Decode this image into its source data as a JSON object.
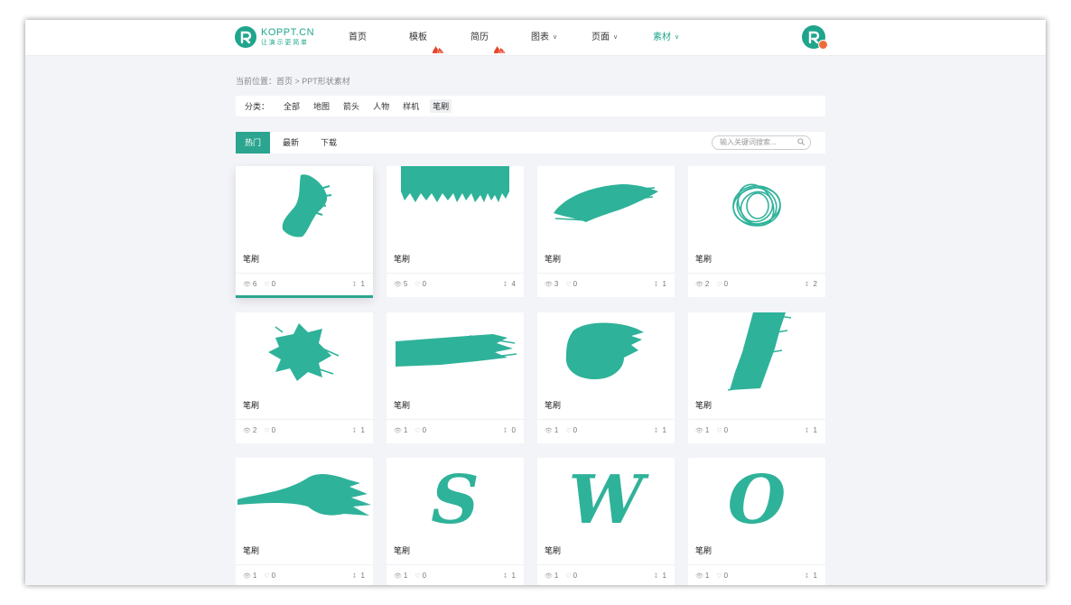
{
  "colors": {
    "accent": "#2ba590",
    "brush": "#2fb29a",
    "badge": "#ef6a3a",
    "background": "#f3f4f8"
  },
  "logo": {
    "title": "KOPPT.CN",
    "subtitle": "让演示更简单"
  },
  "nav": {
    "home": "首页",
    "templates": "模板",
    "resume": "简历",
    "charts": "图表",
    "pages": "页面",
    "assets": "素材",
    "hot_badge_icon": "hot-flame-icon"
  },
  "breadcrumb": "当前位置：首页 > PPT形状素材",
  "filter": {
    "label": "分类：",
    "options": [
      "全部",
      "地图",
      "箭头",
      "人物",
      "样机",
      "笔刷"
    ],
    "selected": "笔刷"
  },
  "tabs": [
    "热门",
    "最新",
    "下载"
  ],
  "active_tab": "热门",
  "search": {
    "placeholder": "输入关键词搜索..."
  },
  "cards": [
    {
      "title": "笔刷",
      "views": "6",
      "likes": "0",
      "downloads": "1",
      "shape": "brush-swoosh"
    },
    {
      "title": "笔刷",
      "views": "5",
      "likes": "0",
      "downloads": "4",
      "shape": "brush-top-band"
    },
    {
      "title": "笔刷",
      "views": "3",
      "likes": "0",
      "downloads": "1",
      "shape": "brush-diagonal-stroke"
    },
    {
      "title": "笔刷",
      "views": "2",
      "likes": "0",
      "downloads": "2",
      "shape": "brush-scribble-circle"
    },
    {
      "title": "笔刷",
      "views": "2",
      "likes": "0",
      "downloads": "1",
      "shape": "brush-splat"
    },
    {
      "title": "笔刷",
      "views": "1",
      "likes": "0",
      "downloads": "0",
      "shape": "brush-horizontal-stroke"
    },
    {
      "title": "笔刷",
      "views": "1",
      "likes": "0",
      "downloads": "1",
      "shape": "brush-blob"
    },
    {
      "title": "笔刷",
      "views": "1",
      "likes": "0",
      "downloads": "1",
      "shape": "brush-slash"
    },
    {
      "title": "笔刷",
      "views": "1",
      "likes": "0",
      "downloads": "1",
      "shape": "brush-wave"
    },
    {
      "title": "笔刷",
      "views": "1",
      "likes": "0",
      "downloads": "1",
      "shape": "brush-letter",
      "letter": "S"
    },
    {
      "title": "笔刷",
      "views": "1",
      "likes": "0",
      "downloads": "1",
      "shape": "brush-letter",
      "letter": "W"
    },
    {
      "title": "笔刷",
      "views": "1",
      "likes": "0",
      "downloads": "1",
      "shape": "brush-letter",
      "letter": "O"
    }
  ]
}
